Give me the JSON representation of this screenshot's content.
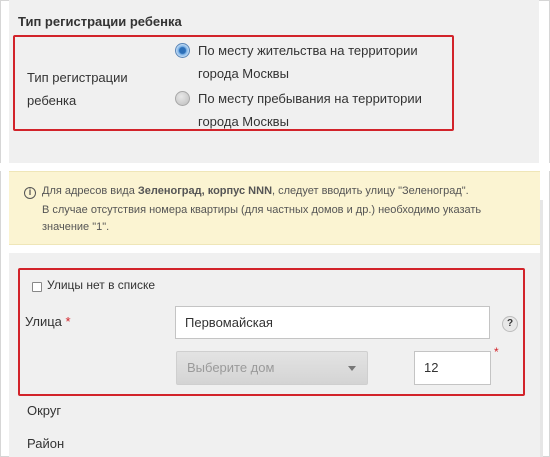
{
  "registration": {
    "section_title": "Тип регистрации ребенка",
    "field_label": "Тип регистрации ребенка",
    "options": [
      {
        "label": "По месту жительства на территории города Москвы",
        "checked": true
      },
      {
        "label": "По месту пребывания на территории города Москвы",
        "checked": false
      }
    ]
  },
  "notice": {
    "icon": "info-icon",
    "line1_prefix": "Для адресов вида ",
    "line1_bold": "Зеленоград, корпус NNN",
    "line1_suffix": ", следует вводить улицу \"Зеленоград\".",
    "line2": "В случае отсутствия номера квартиры (для частных домов и др.) необходимо указать",
    "line3": "значение \"1\"."
  },
  "address": {
    "no_street_checkbox_label": "Улицы нет в списке",
    "no_street_checked": false,
    "street_label": "Улица",
    "required_mark": "*",
    "street_value": "Первомайская",
    "help_icon_text": "?",
    "house_select_placeholder": "Выберите дом",
    "number_value": "12",
    "district_label": "Округ",
    "region_label": "Район"
  },
  "colors": {
    "highlight_border": "#d2232a",
    "panel_bg": "#f0f0f0",
    "notice_bg": "#fbf4d2"
  }
}
